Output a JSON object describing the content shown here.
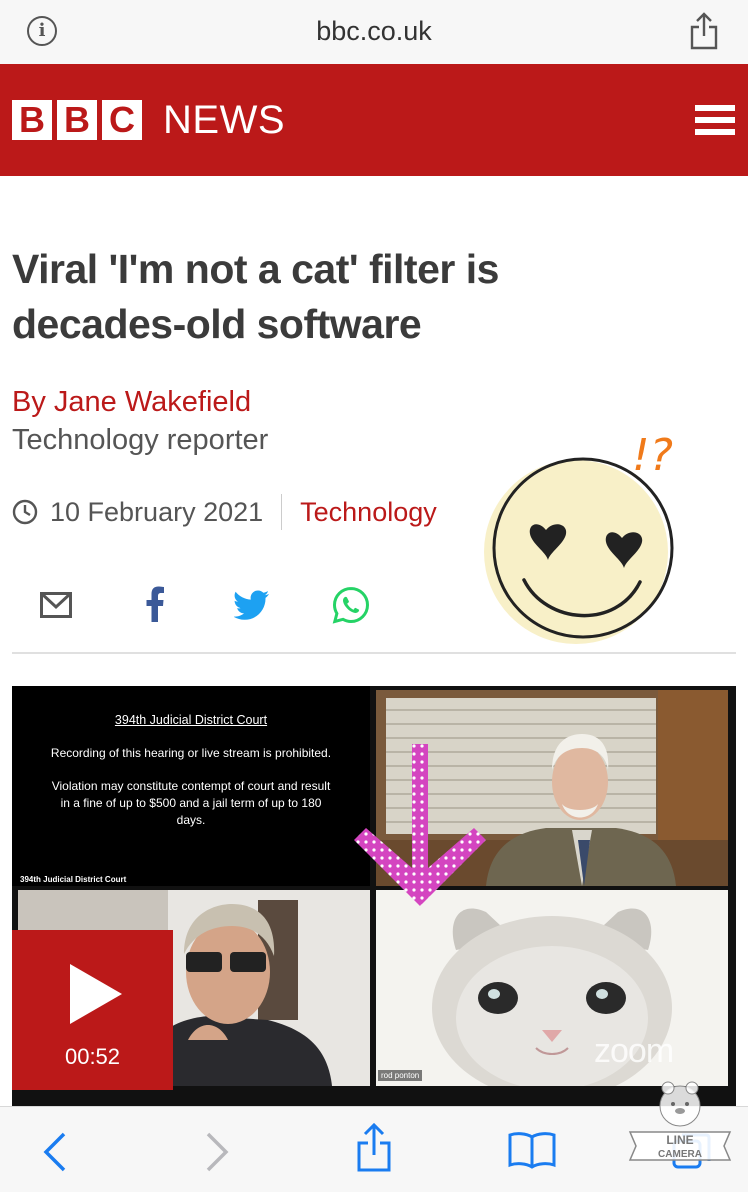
{
  "browser": {
    "url": "bbc.co.uk",
    "info_icon": "info-icon",
    "share_icon": "share-icon"
  },
  "header": {
    "logo_letters": [
      "B",
      "B",
      "C"
    ],
    "logo_word": "NEWS",
    "menu_icon": "hamburger-menu-icon",
    "brand_color": "#bb1919"
  },
  "article": {
    "headline_line1": "Viral 'I'm not a cat' filter is",
    "headline_line2": "decades-old software",
    "byline": "By Jane Wakefield",
    "role": "Technology reporter",
    "date": "10 February 2021",
    "topic": "Technology"
  },
  "share": [
    "email-icon",
    "facebook-icon",
    "twitter-icon",
    "whatsapp-icon"
  ],
  "sticker": {
    "text": "!?",
    "icon": "heart-eyes-smiley-icon"
  },
  "video": {
    "court_title": "394th Judicial District Court",
    "court_notice1": "Recording of this hearing or live stream is prohibited.",
    "court_notice2": "Violation may constitute contempt of court and result in a fine of up to $500 and a jail term of up to 180 days.",
    "court_label": "394th Judicial District Court",
    "cat_name": "rod ponton",
    "watermark": "zoom",
    "duration": "00:52"
  },
  "toolbar": {
    "items": [
      "back-icon",
      "forward-icon",
      "share-icon",
      "bookmarks-icon",
      "tabs-icon"
    ]
  },
  "camera_stamp": {
    "line1": "LINE",
    "line2": "CAMERA"
  }
}
